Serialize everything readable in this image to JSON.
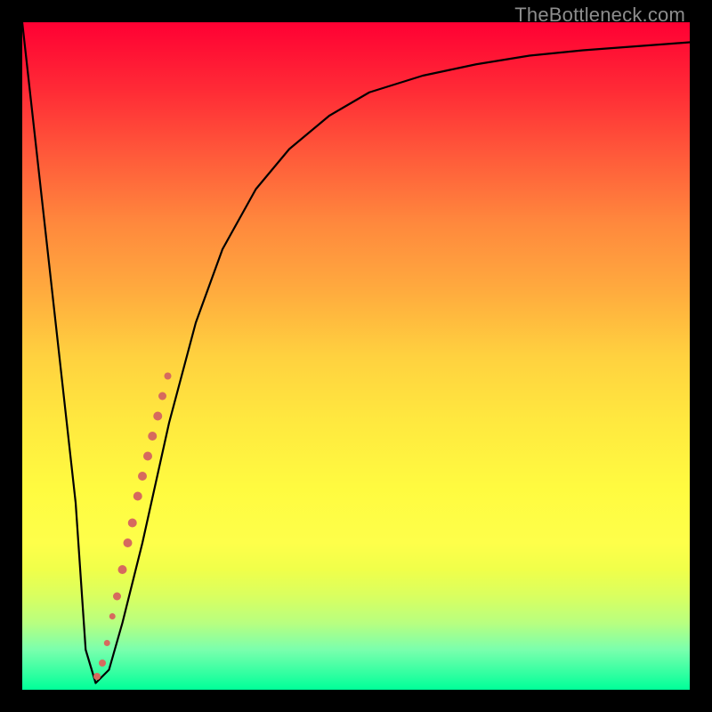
{
  "watermark": "TheBottleneck.com",
  "chart_data": {
    "type": "line",
    "title": "",
    "xlabel": "",
    "ylabel": "",
    "xlim": [
      0,
      100
    ],
    "ylim": [
      0,
      100
    ],
    "grid": false,
    "legend": false,
    "background": "gradient-red-to-green",
    "series": [
      {
        "name": "curve",
        "x": [
          0,
          2,
          4,
          6,
          8,
          9.5,
          11,
          13,
          15,
          18,
          22,
          26,
          30,
          35,
          40,
          46,
          52,
          60,
          68,
          76,
          84,
          92,
          100
        ],
        "y": [
          100,
          82,
          64,
          46,
          28,
          6,
          1,
          3,
          10,
          22,
          40,
          55,
          66,
          75,
          81,
          86,
          89.5,
          92,
          93.7,
          95,
          95.8,
          96.4,
          97
        ]
      }
    ],
    "markers": {
      "name": "highlighted-points",
      "color": "#d66a5e",
      "points": [
        {
          "x": 11.2,
          "y": 2,
          "r": 4
        },
        {
          "x": 12.0,
          "y": 4,
          "r": 4
        },
        {
          "x": 12.7,
          "y": 7,
          "r": 3.5
        },
        {
          "x": 13.5,
          "y": 11,
          "r": 3.5
        },
        {
          "x": 14.2,
          "y": 14,
          "r": 4.5
        },
        {
          "x": 15.0,
          "y": 18,
          "r": 5
        },
        {
          "x": 15.8,
          "y": 22,
          "r": 5
        },
        {
          "x": 16.5,
          "y": 25,
          "r": 5
        },
        {
          "x": 17.3,
          "y": 29,
          "r": 5
        },
        {
          "x": 18.0,
          "y": 32,
          "r": 5
        },
        {
          "x": 18.8,
          "y": 35,
          "r": 5
        },
        {
          "x": 19.5,
          "y": 38,
          "r": 5
        },
        {
          "x": 20.3,
          "y": 41,
          "r": 5
        },
        {
          "x": 21.0,
          "y": 44,
          "r": 4.5
        },
        {
          "x": 21.8,
          "y": 47,
          "r": 4
        }
      ]
    }
  }
}
